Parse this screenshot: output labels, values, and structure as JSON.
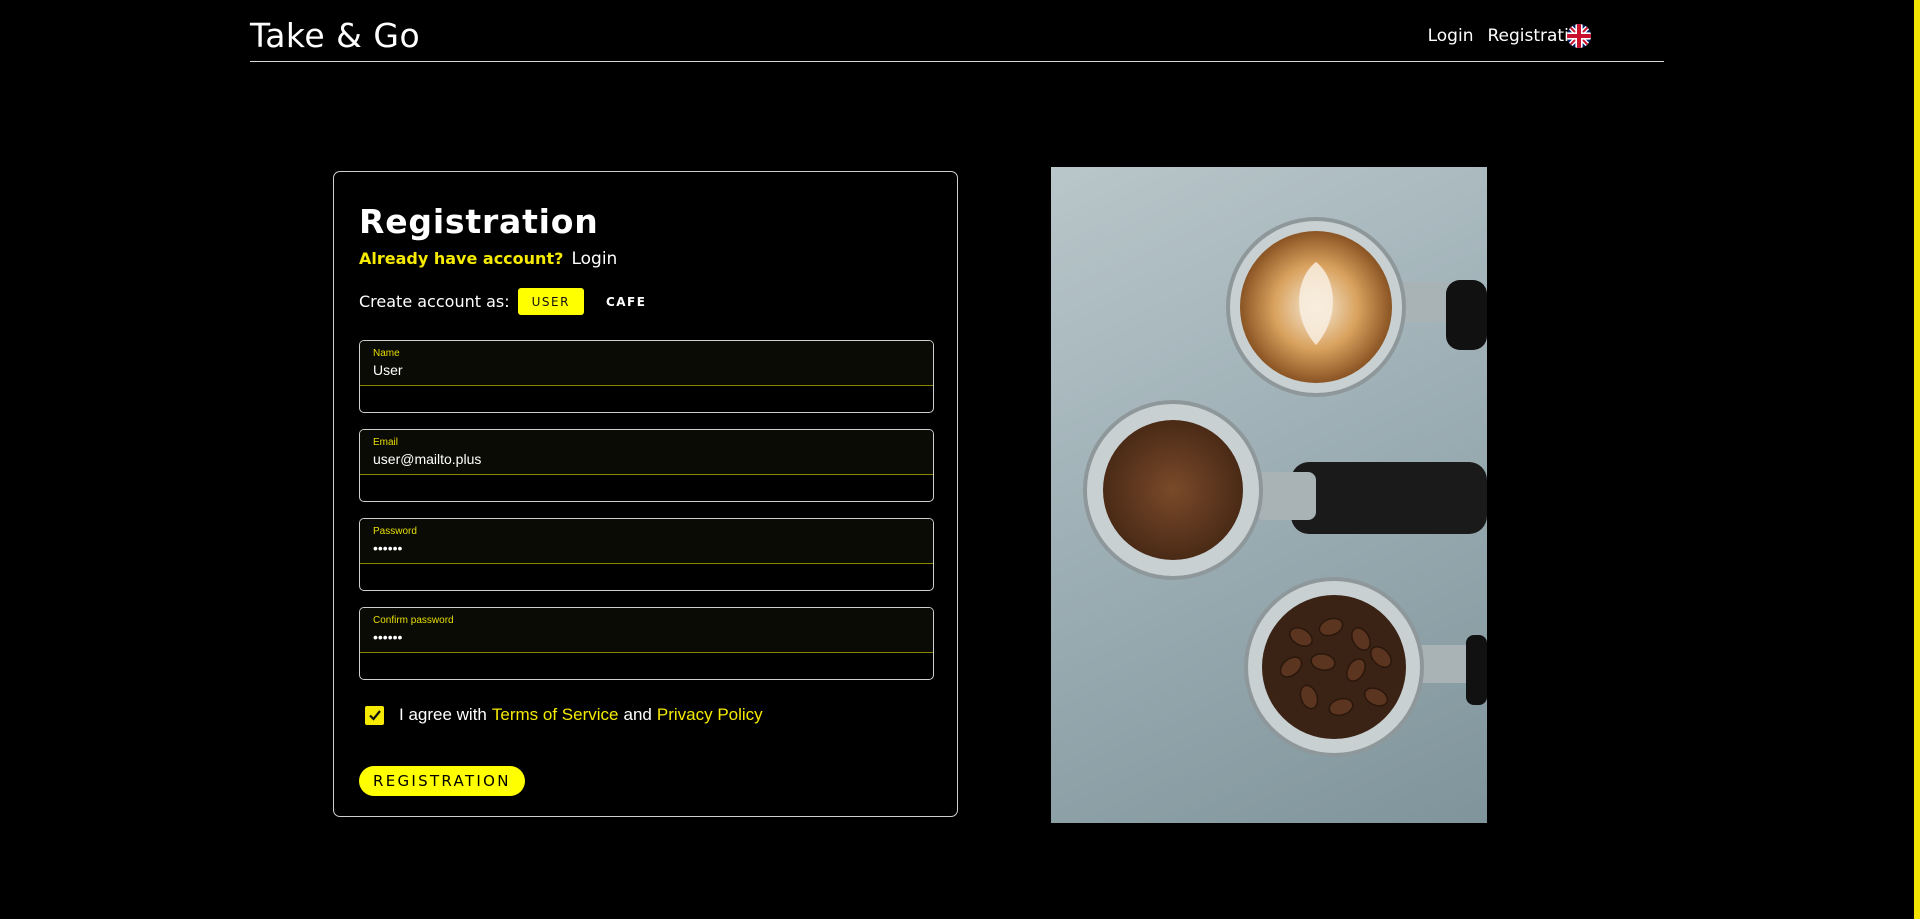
{
  "header": {
    "logo": "Take & Go",
    "nav": {
      "login": "Login",
      "registration": "Registration"
    },
    "language_icon": "uk-flag-icon"
  },
  "form": {
    "title": "Registration",
    "already_question": "Already have account?",
    "login_link": "Login",
    "account_type_label": "Create account as:",
    "roles": {
      "user": "USER",
      "cafe": "CAFE"
    },
    "selected_role": "USER",
    "fields": {
      "name": {
        "label": "Name",
        "value": "User"
      },
      "email": {
        "label": "Email",
        "value": "user@mailto.plus"
      },
      "password": {
        "label": "Password",
        "value": "••••••"
      },
      "confirm_password": {
        "label": "Confirm password",
        "value": "••••••"
      }
    },
    "agree": {
      "checked": true,
      "prefix": "I agree with",
      "terms": "Terms of Service",
      "conjunction": "and",
      "privacy": "Privacy Policy"
    },
    "submit": "REGISTRATION"
  },
  "colors": {
    "accent": "#ffff00",
    "background": "#000000"
  }
}
